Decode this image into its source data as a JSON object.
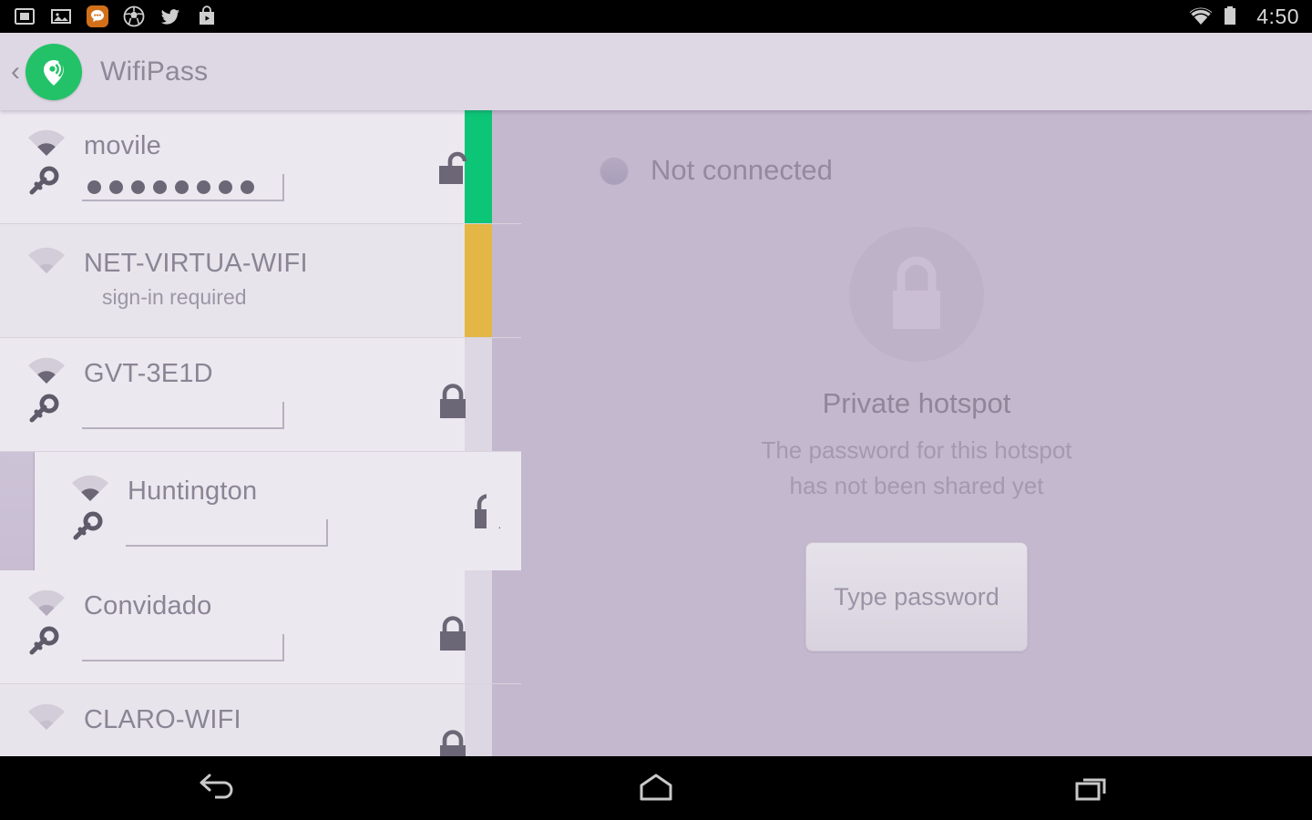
{
  "statusbar": {
    "time": "4:50",
    "left_icons": [
      "screenshot-icon",
      "gallery-icon",
      "chat-app-icon",
      "soccer-app-icon",
      "twitter-icon",
      "play-store-icon"
    ],
    "right_icons": [
      "wifi-signal-icon",
      "battery-icon"
    ]
  },
  "appbar": {
    "back_label": "‹",
    "logo": "wifipass-logo-icon",
    "title": "WifiPass"
  },
  "wifi_list": [
    {
      "ssid": "movile",
      "subtext": "",
      "password_dots": 8,
      "lock_state": "unlocked",
      "edge_color": "#0cc576",
      "selected": false,
      "has_password_field": true
    },
    {
      "ssid": "NET-VIRTUA-WIFI",
      "subtext": "sign-in required",
      "password_dots": 0,
      "lock_state": "none",
      "edge_color": "#e3b646",
      "selected": false,
      "has_password_field": false
    },
    {
      "ssid": "GVT-3E1D",
      "subtext": "",
      "password_dots": 0,
      "lock_state": "locked",
      "edge_color": "#ddd7e3",
      "selected": false,
      "has_password_field": true
    },
    {
      "ssid": "Huntington",
      "subtext": "",
      "password_dots": 0,
      "lock_state": "locked",
      "edge_color": "#ece8f0",
      "selected": true,
      "has_password_field": true
    },
    {
      "ssid": "Convidado",
      "subtext": "",
      "password_dots": 0,
      "lock_state": "locked",
      "edge_color": "#ddd7e3",
      "selected": false,
      "has_password_field": true
    },
    {
      "ssid": "CLARO-WIFI",
      "subtext": "",
      "password_dots": 0,
      "lock_state": "locked",
      "edge_color": "#ddd7e3",
      "selected": false,
      "has_password_field": false
    }
  ],
  "detail": {
    "connection_status": "Not connected",
    "lock_icon": "big-lock-icon",
    "title": "Private hotspot",
    "description_line1": "The password for this hotspot",
    "description_line2": "has not been shared yet",
    "button_label": "Type password"
  },
  "navbar": {
    "buttons": [
      "back-nav-icon",
      "home-nav-icon",
      "recents-nav-icon"
    ]
  },
  "colors": {
    "accent_green": "#23c268",
    "panel_purple": "#c4b8ce",
    "appbar_lavender": "#ded7e4",
    "row_light": "#ece8f0",
    "row_dark": "#e8e4ec",
    "edge_green": "#0cc576",
    "edge_amber": "#e3b646",
    "text_muted": "#8a8594"
  }
}
